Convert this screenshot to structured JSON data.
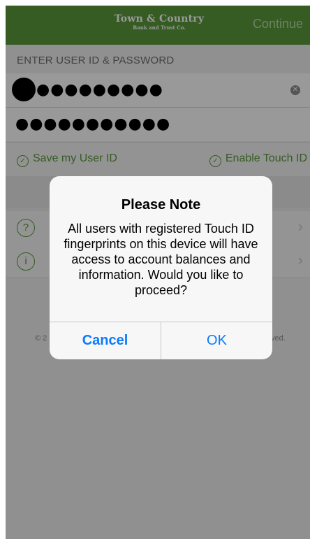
{
  "navbar": {
    "logo_main": "Town & Country",
    "logo_sub": "Bank and Trust Co.",
    "continue_label": "Continue"
  },
  "form": {
    "section_header": "ENTER USER ID & PASSWORD",
    "user_id_masked": "●●●●●●●●●",
    "password_masked": "●●●●●●●●●●●",
    "clear_icon": "clear-circle-icon"
  },
  "options": {
    "save_user_id_label": "Save my User ID",
    "enable_touch_id_label": "Enable Touch ID",
    "check_icon": "✓"
  },
  "list": {
    "items": [
      {
        "icon_text": "?",
        "icon": "question-circle-icon"
      },
      {
        "icon_text": "i",
        "icon": "info-circle-icon"
      }
    ],
    "chevron": "›"
  },
  "footer": {
    "left_fragment": "© 2",
    "right_fragment": "ved."
  },
  "alert": {
    "title": "Please Note",
    "message": "All users with registered Touch ID fingerprints on this device will have access to account balances and information. Would you like to proceed?",
    "cancel_label": "Cancel",
    "ok_label": "OK"
  },
  "colors": {
    "brand_green": "#5a9a3c",
    "ios_blue": "#0a7aff"
  }
}
